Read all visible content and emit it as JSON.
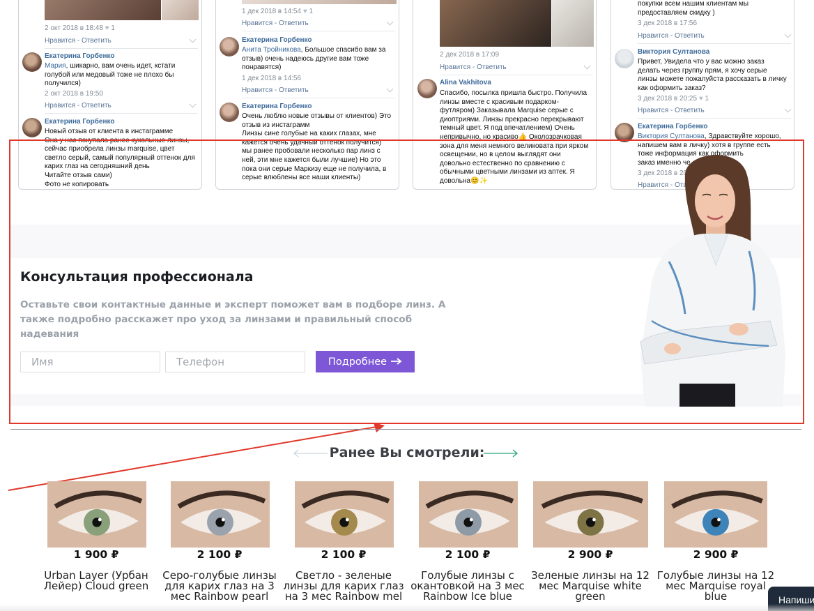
{
  "reviews": {
    "actions_label": "Нравится - Ответить",
    "col1": {
      "top_meta": "2 окт 2018 в 18:48",
      "top_likes": "1",
      "c1": {
        "author": "Екатерина Горбенко",
        "reply_to": "Мария",
        "lines": [
          ", шикарно, вам очень идет, кстати",
          "голубой или медовый тоже не плохо бы",
          "получился)"
        ],
        "meta": "2 окт 2018 в 19:50"
      },
      "c2": {
        "author": "Екатерина Горбенко",
        "lines": [
          "Новый отзыв от клиента в инстаграмме",
          "Она у нас покупала ранее кукольные линзы,",
          "сейчас приобрела линзы marquise, цвет",
          "светло серый, самый популярный оттенок для",
          "карих глаз на сегодняшний день",
          "Читайте отзыв сами)",
          "Фото не копировать"
        ]
      }
    },
    "col2": {
      "top_meta": "1 дек 2018 в 14:54",
      "top_likes": "1",
      "c1": {
        "author": "Екатерина Горбенко",
        "reply_to": "Анита Тройникова",
        "lines": [
          ", Большое спасибо вам за",
          "отзыв) очень надеюсь другие вам тоже",
          "понравятся)"
        ],
        "meta": "1 дек 2018 в 14:56"
      },
      "c2": {
        "author": "Екатерина Горбенко",
        "lines": [
          "Очень люблю новые отзывы от клиентов) Это",
          "отзыв из инстаграмм",
          "Линзы сине голубые на каких глазах, мне",
          "кажется очень удачный оттенок получится)",
          "мы ранее пробовали несколько пар линз с",
          "ней, эти мне кажется были лучшие) Но это",
          "пока они серые Маркизу еще не получила, в",
          "серые влюблены все наши клиенты)"
        ]
      }
    },
    "col3": {
      "top_meta": "2 дек 2018 в 17:09",
      "c1": {
        "author": "Alina Vakhitova",
        "lines": [
          "Спасибо, посылка пришла быстро. Получила",
          "линзы вместе с красивым подарком-",
          "футляром) Заказывала Marquise серые с",
          "диоптриями. Линзы прекрасно перекрывают",
          "темный цвет. Я под впечатлением) Очень",
          "непривычно, но красиво👍 Околозрачковая",
          "зона для меня немного великовата при ярком",
          "освещении, но в целом выглядят они",
          "довольно естественно по сравнению с",
          "обычными цветными линзами из аптек. Я",
          "довольна😊✨"
        ]
      }
    },
    "col4": {
      "top_lines": [
        "покупки всем нашим клиентам мы",
        "предоставляем скидку )"
      ],
      "top_meta": "3 дек 2018 в 17:56",
      "c1": {
        "author": "Виктория Султанова",
        "lines": [
          "Привет, Увидела что у вас можно заказ",
          "делать через группу прям, я хочу серые",
          "линзы можете пожалуйста рассказать в личку",
          "как оформить заказ?"
        ],
        "meta": "3 дек 2018 в 20:25",
        "likes": "1"
      },
      "c2": {
        "author": "Екатерина Горбенко",
        "reply_to": "Виктория Султанова",
        "lines": [
          ", Здравствуйте хорошо,",
          "напишем вам в личку) хотя в группе есть",
          "тоже информация как оформить",
          "заказ именно че"
        ],
        "meta": "3 дек 2018 в 20:"
      }
    }
  },
  "consult": {
    "title": "Консультация профессионала",
    "text": "Оставьте свои контактные данные и эксперт поможет вам в подборе линз. А также подробно расскажет про уход за линзами и правильный способ надевания",
    "name_placeholder": "Имя",
    "phone_placeholder": "Телефон",
    "button_label": "Подробнее",
    "button_icon": "arrow-right-icon"
  },
  "previously_viewed": {
    "title": "Ранее Вы смотрели:",
    "products": [
      {
        "price": "1 900 ₽",
        "name": "Urban Layer (Урбан Лейер) Cloud green",
        "iris": "#8aa07a"
      },
      {
        "price": "2 100 ₽",
        "name": "Серо-голубые линзы для карих глаз на 3 мес Rainbow pearl",
        "iris": "#9aa3ad"
      },
      {
        "price": "2 100 ₽",
        "name": "Светло - зеленые линзы для карих глаз на 3 мес Rainbow mel",
        "iris": "#a58a4e"
      },
      {
        "price": "2 100 ₽",
        "name": "Голубые линзы с окантовкой на 3 мес Rainbow Ice blue",
        "iris": "#8e9ba6"
      },
      {
        "price": "2 900 ₽",
        "name": "Зеленые линзы на 12 мес Marquise white green",
        "iris": "#7d7344"
      },
      {
        "price": "2 900 ₽",
        "name": "Голубые линзы на 12 мес Marquise royal blue",
        "iris": "#3f84b8"
      }
    ]
  },
  "chat": {
    "label": "Напиши"
  },
  "colors": {
    "accent": "#7e57d6",
    "annotation": "#e0392b",
    "link": "#3d6a9a"
  }
}
